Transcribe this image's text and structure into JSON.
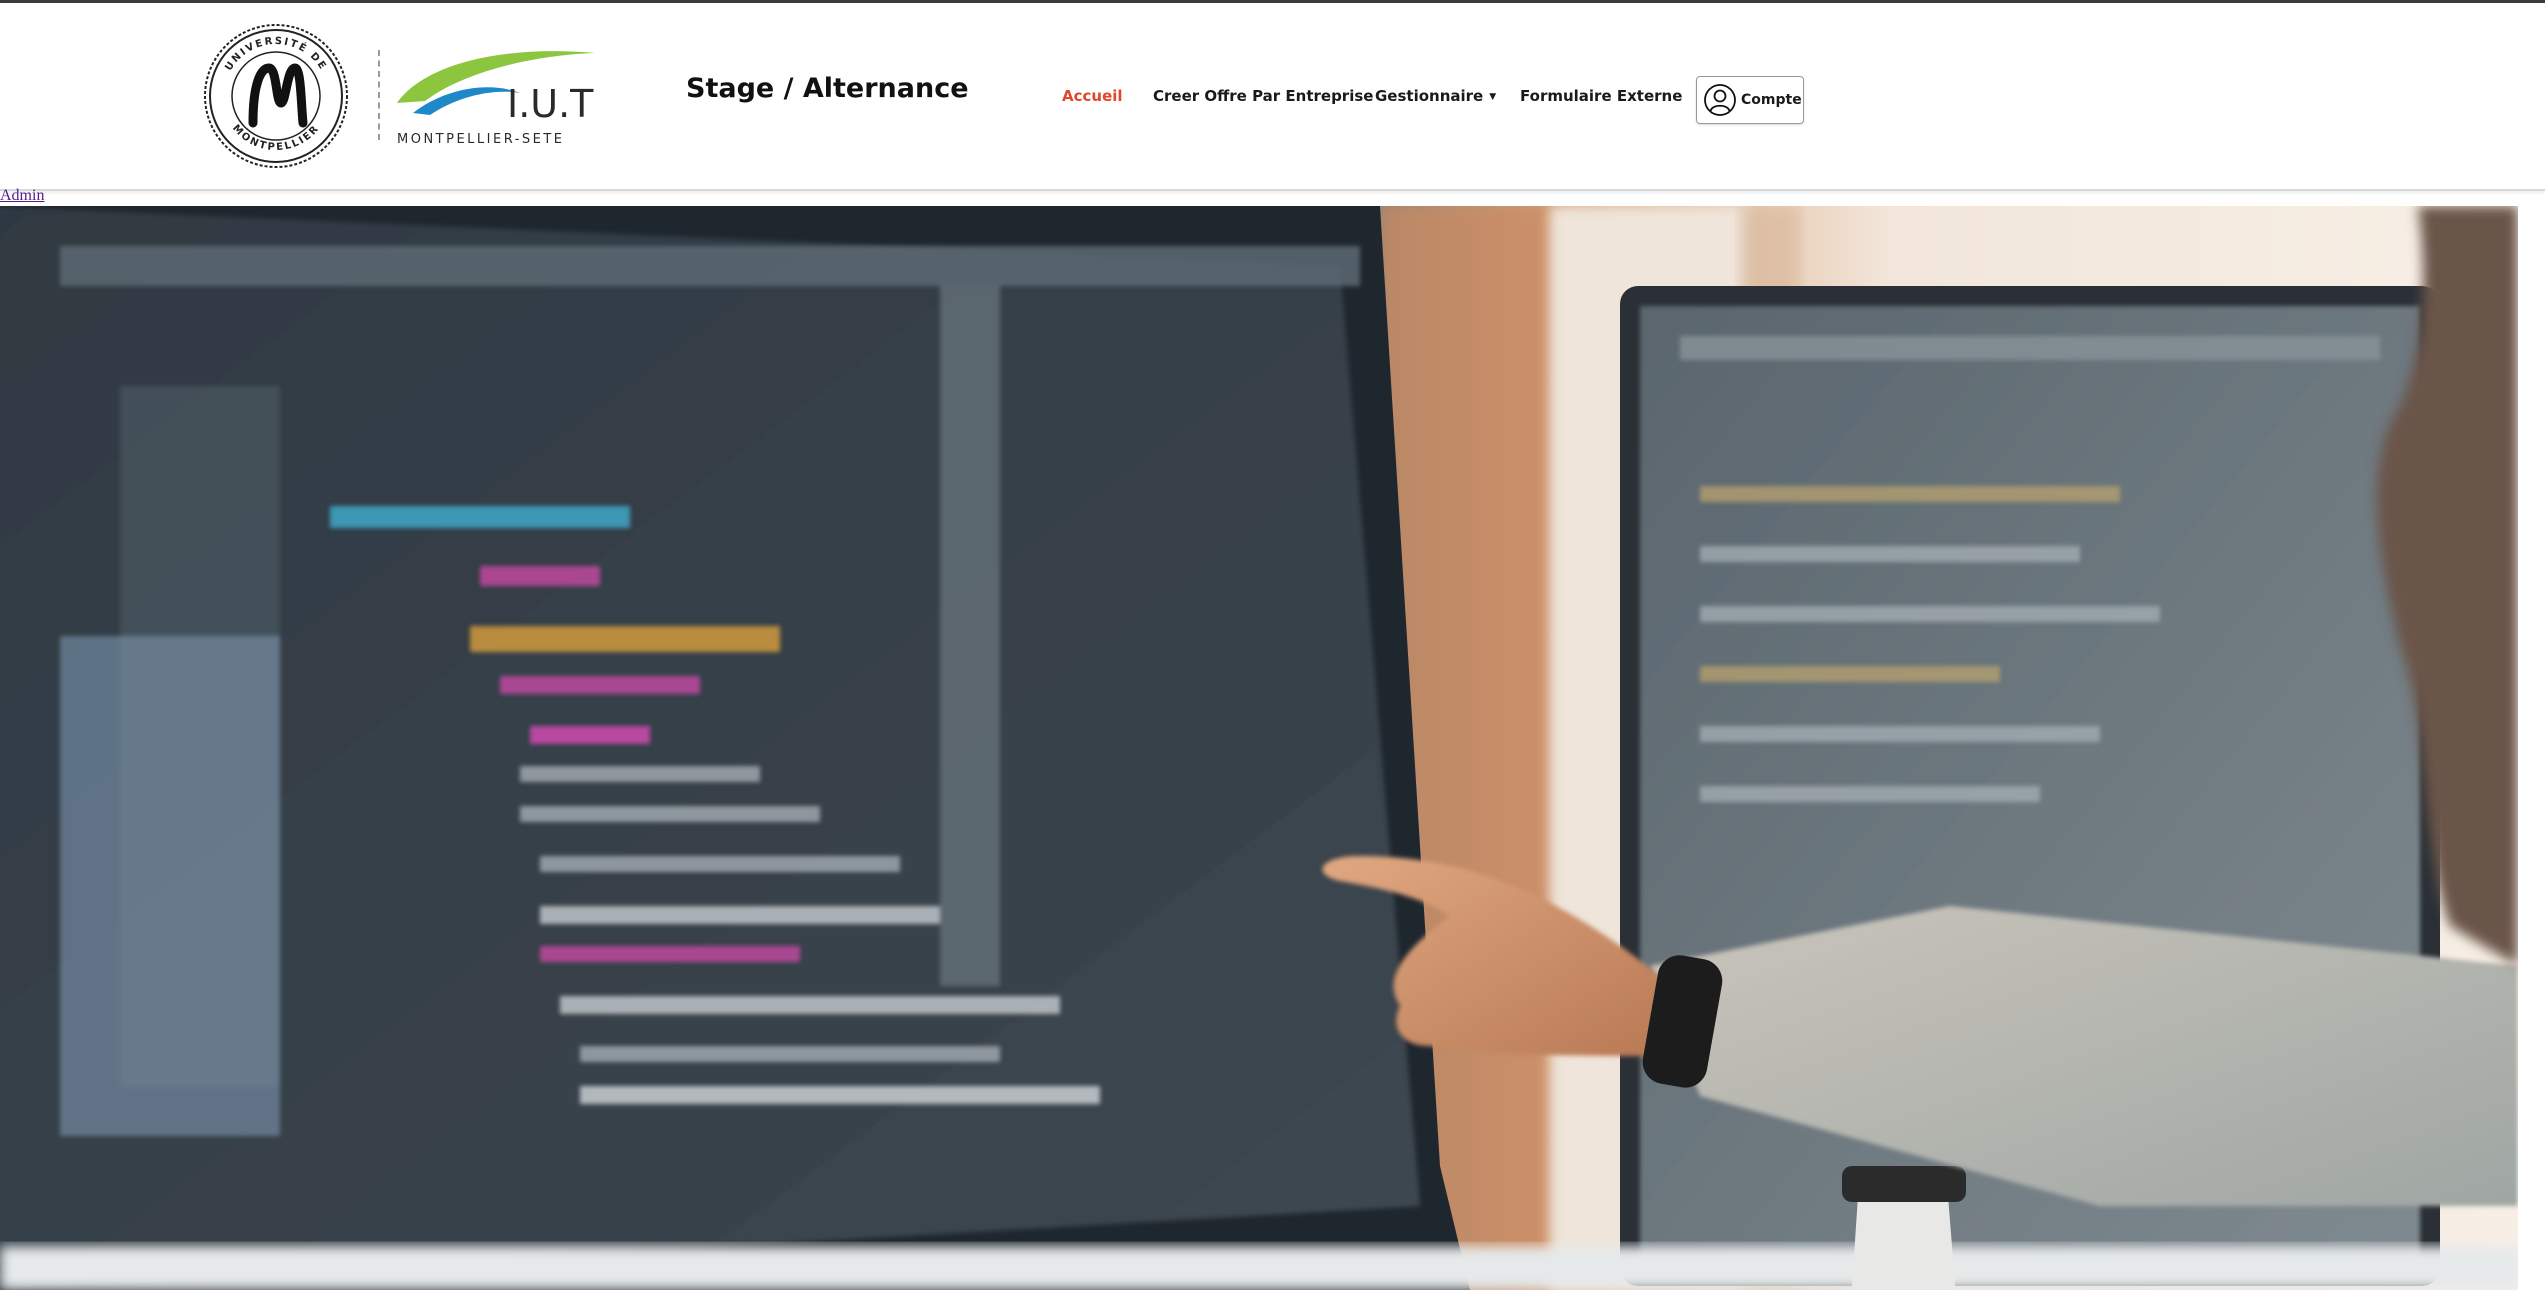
{
  "header": {
    "university_logo": {
      "icon": "universite-montpellier-seal-icon",
      "text": "UNIVERSITÉ DE MONTPELLIER"
    },
    "iut_logo": {
      "icon": "iut-montpellier-sete-logo-icon",
      "main_text": "I.U.T",
      "sub_text": "MONTPELLIER-SETE"
    },
    "site_title": "Stage / Alternance"
  },
  "nav": {
    "items": [
      {
        "label": "Accueil",
        "active": true
      },
      {
        "label": "Creer Offre Par Entreprise",
        "active": false
      },
      {
        "label": "Gestionnaire",
        "active": false,
        "has_dropdown": true
      },
      {
        "label": "Formulaire Externe",
        "active": false
      }
    ],
    "account_button": {
      "label": "Compte",
      "icon": "user-circle-icon"
    }
  },
  "admin_link": "Admin",
  "hero": {
    "icon": "hero-photo-developer-pointing-at-code-screens"
  },
  "colors": {
    "accent_active": "#e0462b",
    "nav_text": "#1a1a1a",
    "link_visited": "#551a8b",
    "top_strip": "#3a3a3a",
    "iut_green": "#8cc63f",
    "iut_blue": "#1e88c8"
  }
}
